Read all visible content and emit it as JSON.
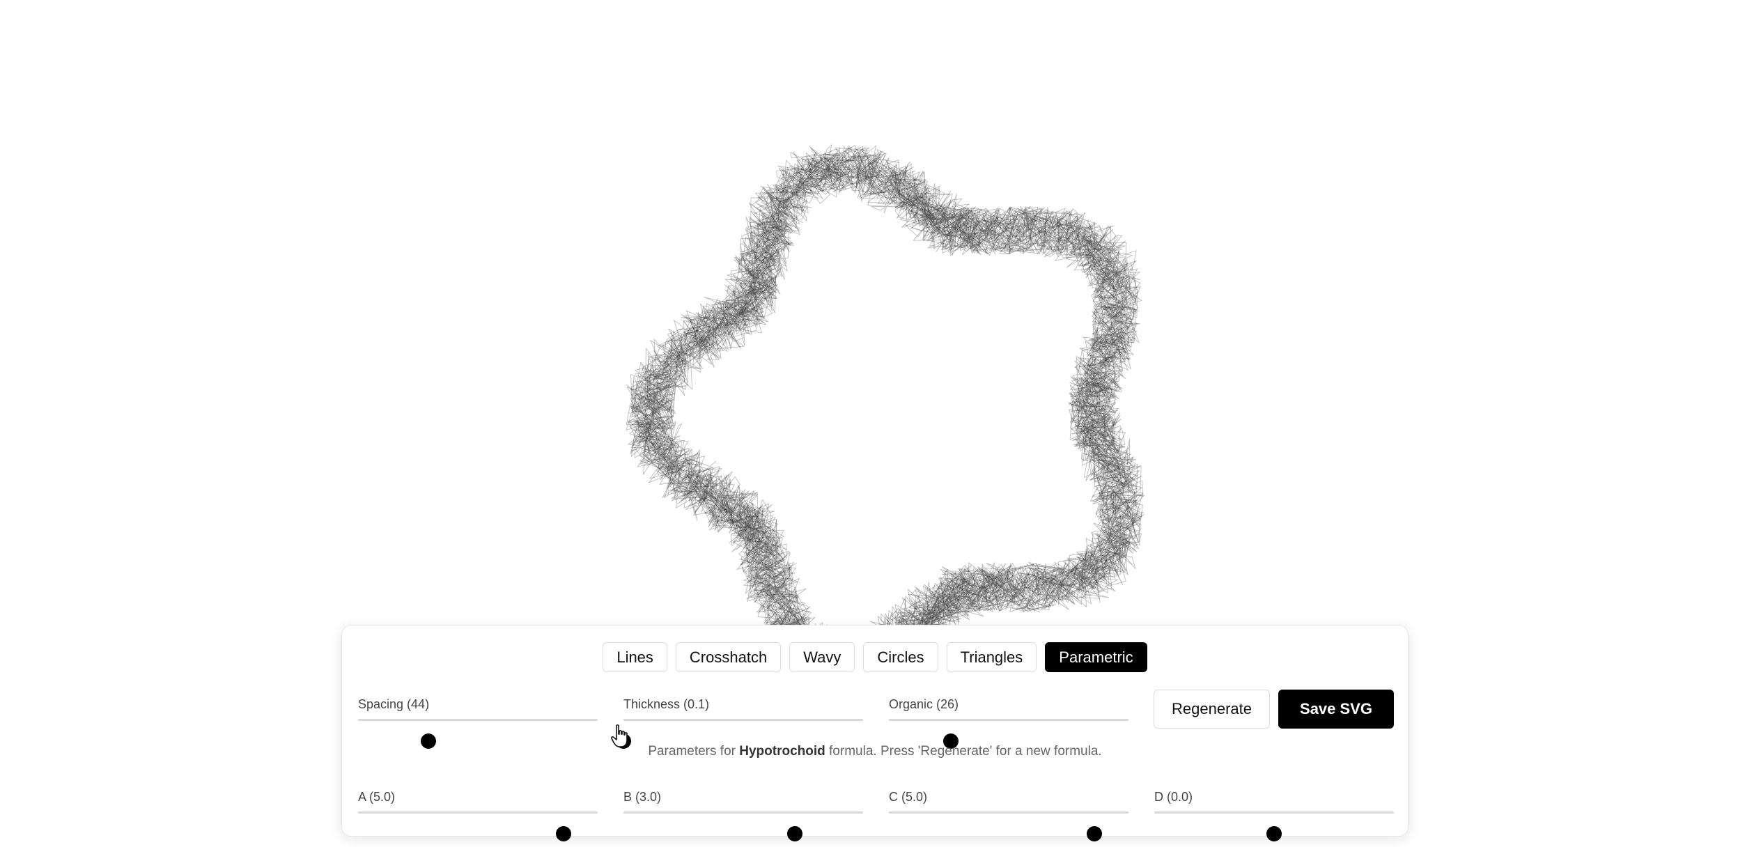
{
  "art": {
    "formula": "Hypotrochoid",
    "stroke_color": "#1a1a1a"
  },
  "tabs": [
    {
      "label": "Lines",
      "active": false
    },
    {
      "label": "Crosshatch",
      "active": false
    },
    {
      "label": "Wavy",
      "active": false
    },
    {
      "label": "Circles",
      "active": false
    },
    {
      "label": "Triangles",
      "active": false
    },
    {
      "label": "Parametric",
      "active": true
    }
  ],
  "controls": {
    "spacing": {
      "label": "Spacing (44)",
      "value": 44,
      "min": 4,
      "max": 140
    },
    "thickness": {
      "label": "Thickness (0.1)",
      "value": 0.1,
      "min": 0.1,
      "max": 10
    },
    "organic": {
      "label": "Organic (26)",
      "value": 26,
      "min": 0,
      "max": 100
    }
  },
  "buttons": {
    "regenerate": "Regenerate",
    "save": "Save SVG"
  },
  "hint": {
    "prefix": "Parameters for ",
    "formula": "Hypotrochoid",
    "suffix": " formula. Press 'Regenerate' for a new formula."
  },
  "params": {
    "a": {
      "label": "A (5.0)",
      "value": 5.0,
      "min": -7,
      "max": 7
    },
    "b": {
      "label": "B (3.0)",
      "value": 3.0,
      "min": -7,
      "max": 7
    },
    "c": {
      "label": "C (5.0)",
      "value": 5.0,
      "min": -7,
      "max": 7
    },
    "d": {
      "label": "D (0.0)",
      "value": 0.0,
      "min": -7,
      "max": 7
    }
  },
  "icons": {
    "cursor": "hand-pointer-icon"
  }
}
